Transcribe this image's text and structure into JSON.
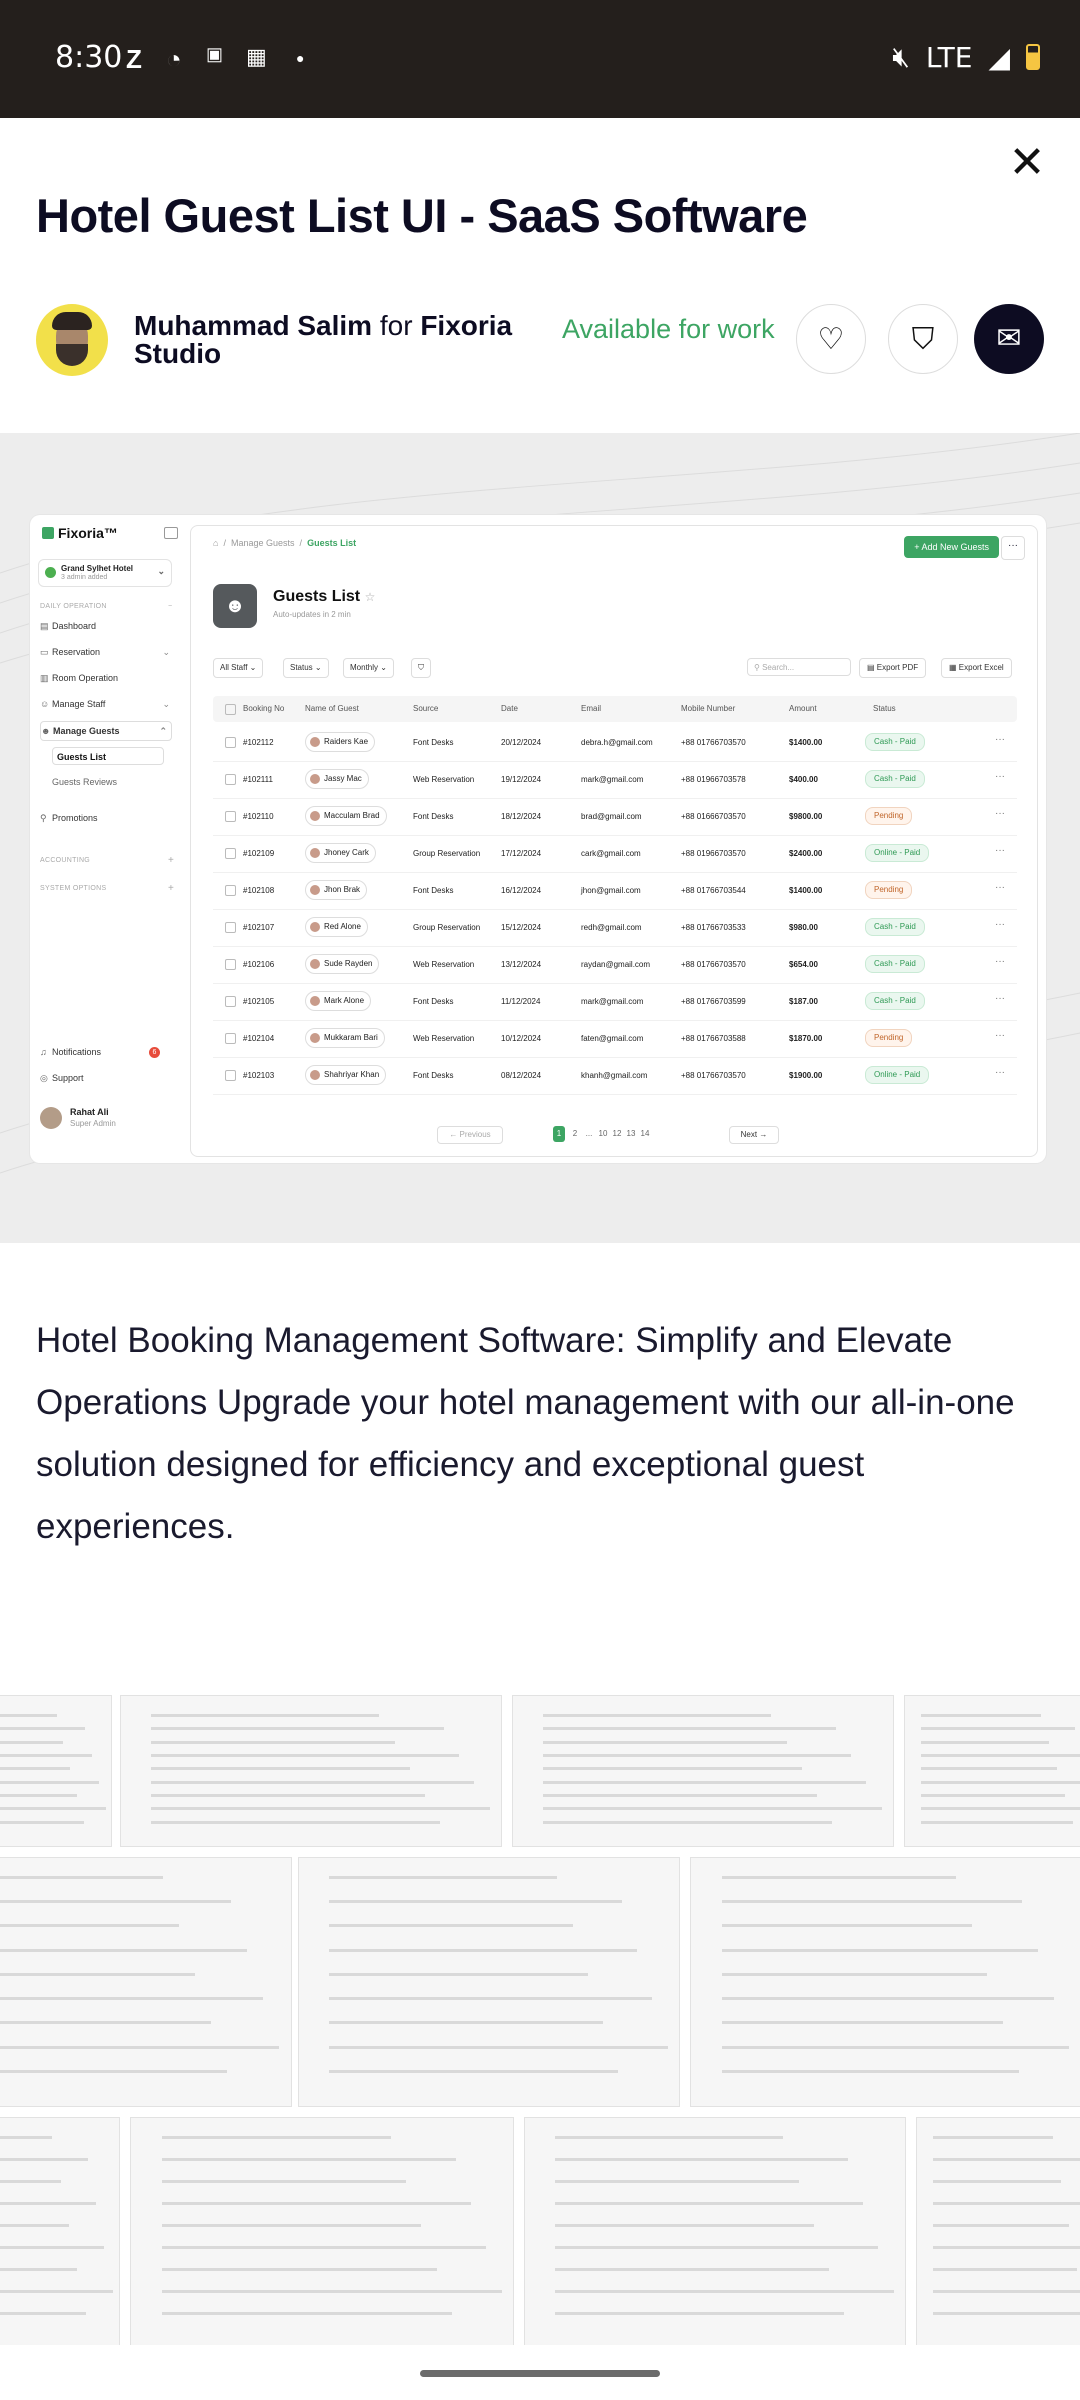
{
  "status_bar": {
    "time": "8:30",
    "network": "LTE"
  },
  "header": {
    "title": "Hotel Guest List UI - SaaS Software",
    "author_name": "Muhammad Salim",
    "for_word": "for",
    "team_name": "Fixoria Studio",
    "availability": "Available for work"
  },
  "app": {
    "logo": "Fixoria™",
    "hotel_name": "Grand Sylhet Hotel",
    "hotel_sub": "3 admin added",
    "sections": {
      "daily": "DAILY OPERATION",
      "accounting": "ACCOUNTING",
      "system": "SYSTEM OPTIONS"
    },
    "nav": [
      "Dashboard",
      "Reservation",
      "Room Operation",
      "Manage Staff",
      "Manage Guests"
    ],
    "subnav": [
      "Guests List",
      "Guests Reviews"
    ],
    "promotions": "Promotions",
    "notifications": "Notifications",
    "notif_count": "6",
    "support": "Support",
    "user_name": "Rahat Ali",
    "user_role": "Super Admin",
    "breadcrumb": {
      "sep": "/",
      "parent": "Manage Guests",
      "current": "Guests List"
    },
    "add_button": "+ Add New Guests",
    "more": "···",
    "page_title": "Guests List",
    "page_sub": "Auto-updates in 2 min",
    "filters": [
      "All Staff ⌄",
      "Status ⌄",
      "Monthly ⌄",
      "⛉"
    ],
    "search_placeholder": "Search...",
    "export_pdf": "Export PDF",
    "export_excel": "Export Excel",
    "columns": [
      "Booking No",
      "Name of Guest",
      "Source",
      "Date",
      "Email",
      "Mobile Number",
      "Amount",
      "Status"
    ],
    "rows": [
      [
        "#102112",
        "Raiders Kae",
        "Font Desks",
        "20/12/2024",
        "debra.h@gmail.com",
        "+88 01766703570",
        "$1400.00",
        "Cash - Paid"
      ],
      [
        "#102111",
        "Jassy Mac",
        "Web Reservation",
        "19/12/2024",
        "mark@gmail.com",
        "+88 01966703578",
        "$400.00",
        "Cash - Paid"
      ],
      [
        "#102110",
        "Macculam Brad",
        "Font Desks",
        "18/12/2024",
        "brad@gmail.com",
        "+88 01666703570",
        "$9800.00",
        "Pending"
      ],
      [
        "#102109",
        "Jhoney Cark",
        "Group Reservation",
        "17/12/2024",
        "cark@gmail.com",
        "+88 01966703570",
        "$2400.00",
        "Online - Paid"
      ],
      [
        "#102108",
        "Jhon Brak",
        "Font Desks",
        "16/12/2024",
        "jhon@gmail.com",
        "+88 01766703544",
        "$1400.00",
        "Pending"
      ],
      [
        "#102107",
        "Red Alone",
        "Group Reservation",
        "15/12/2024",
        "redh@gmail.com",
        "+88 01766703533",
        "$980.00",
        "Cash - Paid"
      ],
      [
        "#102106",
        "Sude Rayden",
        "Web Reservation",
        "13/12/2024",
        "raydan@gmail.com",
        "+88 01766703570",
        "$654.00",
        "Cash - Paid"
      ],
      [
        "#102105",
        "Mark Alone",
        "Font Desks",
        "11/12/2024",
        "mark@gmail.com",
        "+88 01766703599",
        "$187.00",
        "Cash - Paid"
      ],
      [
        "#102104",
        "Mukkaram Bari",
        "Web Reservation",
        "10/12/2024",
        "faten@gmail.com",
        "+88 01766703588",
        "$1870.00",
        "Pending"
      ],
      [
        "#102103",
        "Shahriyar Khan",
        "Font Desks",
        "08/12/2024",
        "khanh@gmail.com",
        "+88 01766703570",
        "$1900.00",
        "Online - Paid"
      ]
    ],
    "pager": {
      "prev": "← Previous",
      "pages": [
        "1",
        "2",
        "...",
        "10",
        "12",
        "13",
        "14"
      ],
      "next": "Next →"
    }
  },
  "description": "Hotel Booking Management Software: Simplify and Elevate Operations Upgrade your hotel management with our all-in-one solution designed for efficiency and exceptional guest experiences.",
  "colors": {
    "accent_green": "#3da563",
    "dark": "#0d0c22"
  }
}
